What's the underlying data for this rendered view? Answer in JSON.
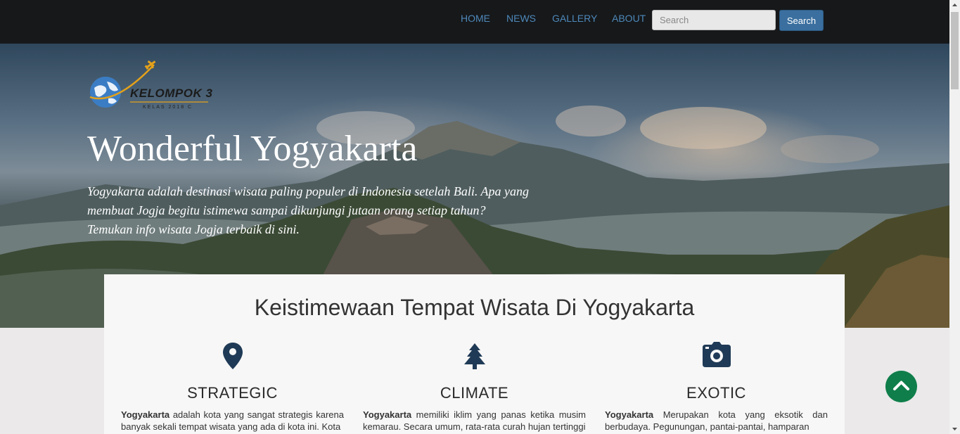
{
  "nav": {
    "items": [
      "HOME",
      "NEWS",
      "GALLERY",
      "ABOUT"
    ],
    "search_placeholder": "Search",
    "search_button": "Search",
    "link_color": "#4e88b9"
  },
  "logo": {
    "name": "KELOMPOK 3",
    "subtitle": "KELAS 2018 C",
    "icons": [
      "globe-icon",
      "airplane-icon"
    ]
  },
  "hero": {
    "title": "Wonderful Yogyakarta",
    "description": "Yogyakarta adalah destinasi wisata paling populer di Indonesia setelah Bali. Apa yang membuat Jogja begitu istimewa sampai dikunjungi jutaan orang setiap tahun? Temukan info wisata Jogja terbaik di sini."
  },
  "features": {
    "title": "Keistimewaan Tempat Wisata Di Yogyakarta",
    "icon_color": "#1f3a56",
    "items": [
      {
        "icon": "map-marker-icon",
        "heading": "STRATEGIC",
        "bold": "Yogyakarta",
        "text": " adalah kota yang sangat strategis karena banyak sekali tempat wisata yang ada di kota ini. Kota"
      },
      {
        "icon": "tree-icon",
        "heading": "CLIMATE",
        "bold": "Yogyakarta",
        "text": " memiliki iklim yang panas ketika musim kemarau. Secara umum, rata-rata curah hujan tertinggi"
      },
      {
        "icon": "camera-icon",
        "heading": "EXOTIC",
        "bold": "Yogyakarta",
        "text": " Merupakan kota yang eksotik dan berbudaya. Pegunungan, pantai-pantai, hamparan"
      }
    ]
  },
  "back_to_top": {
    "icon": "chevron-up-icon",
    "color": "#0f7e4a"
  }
}
